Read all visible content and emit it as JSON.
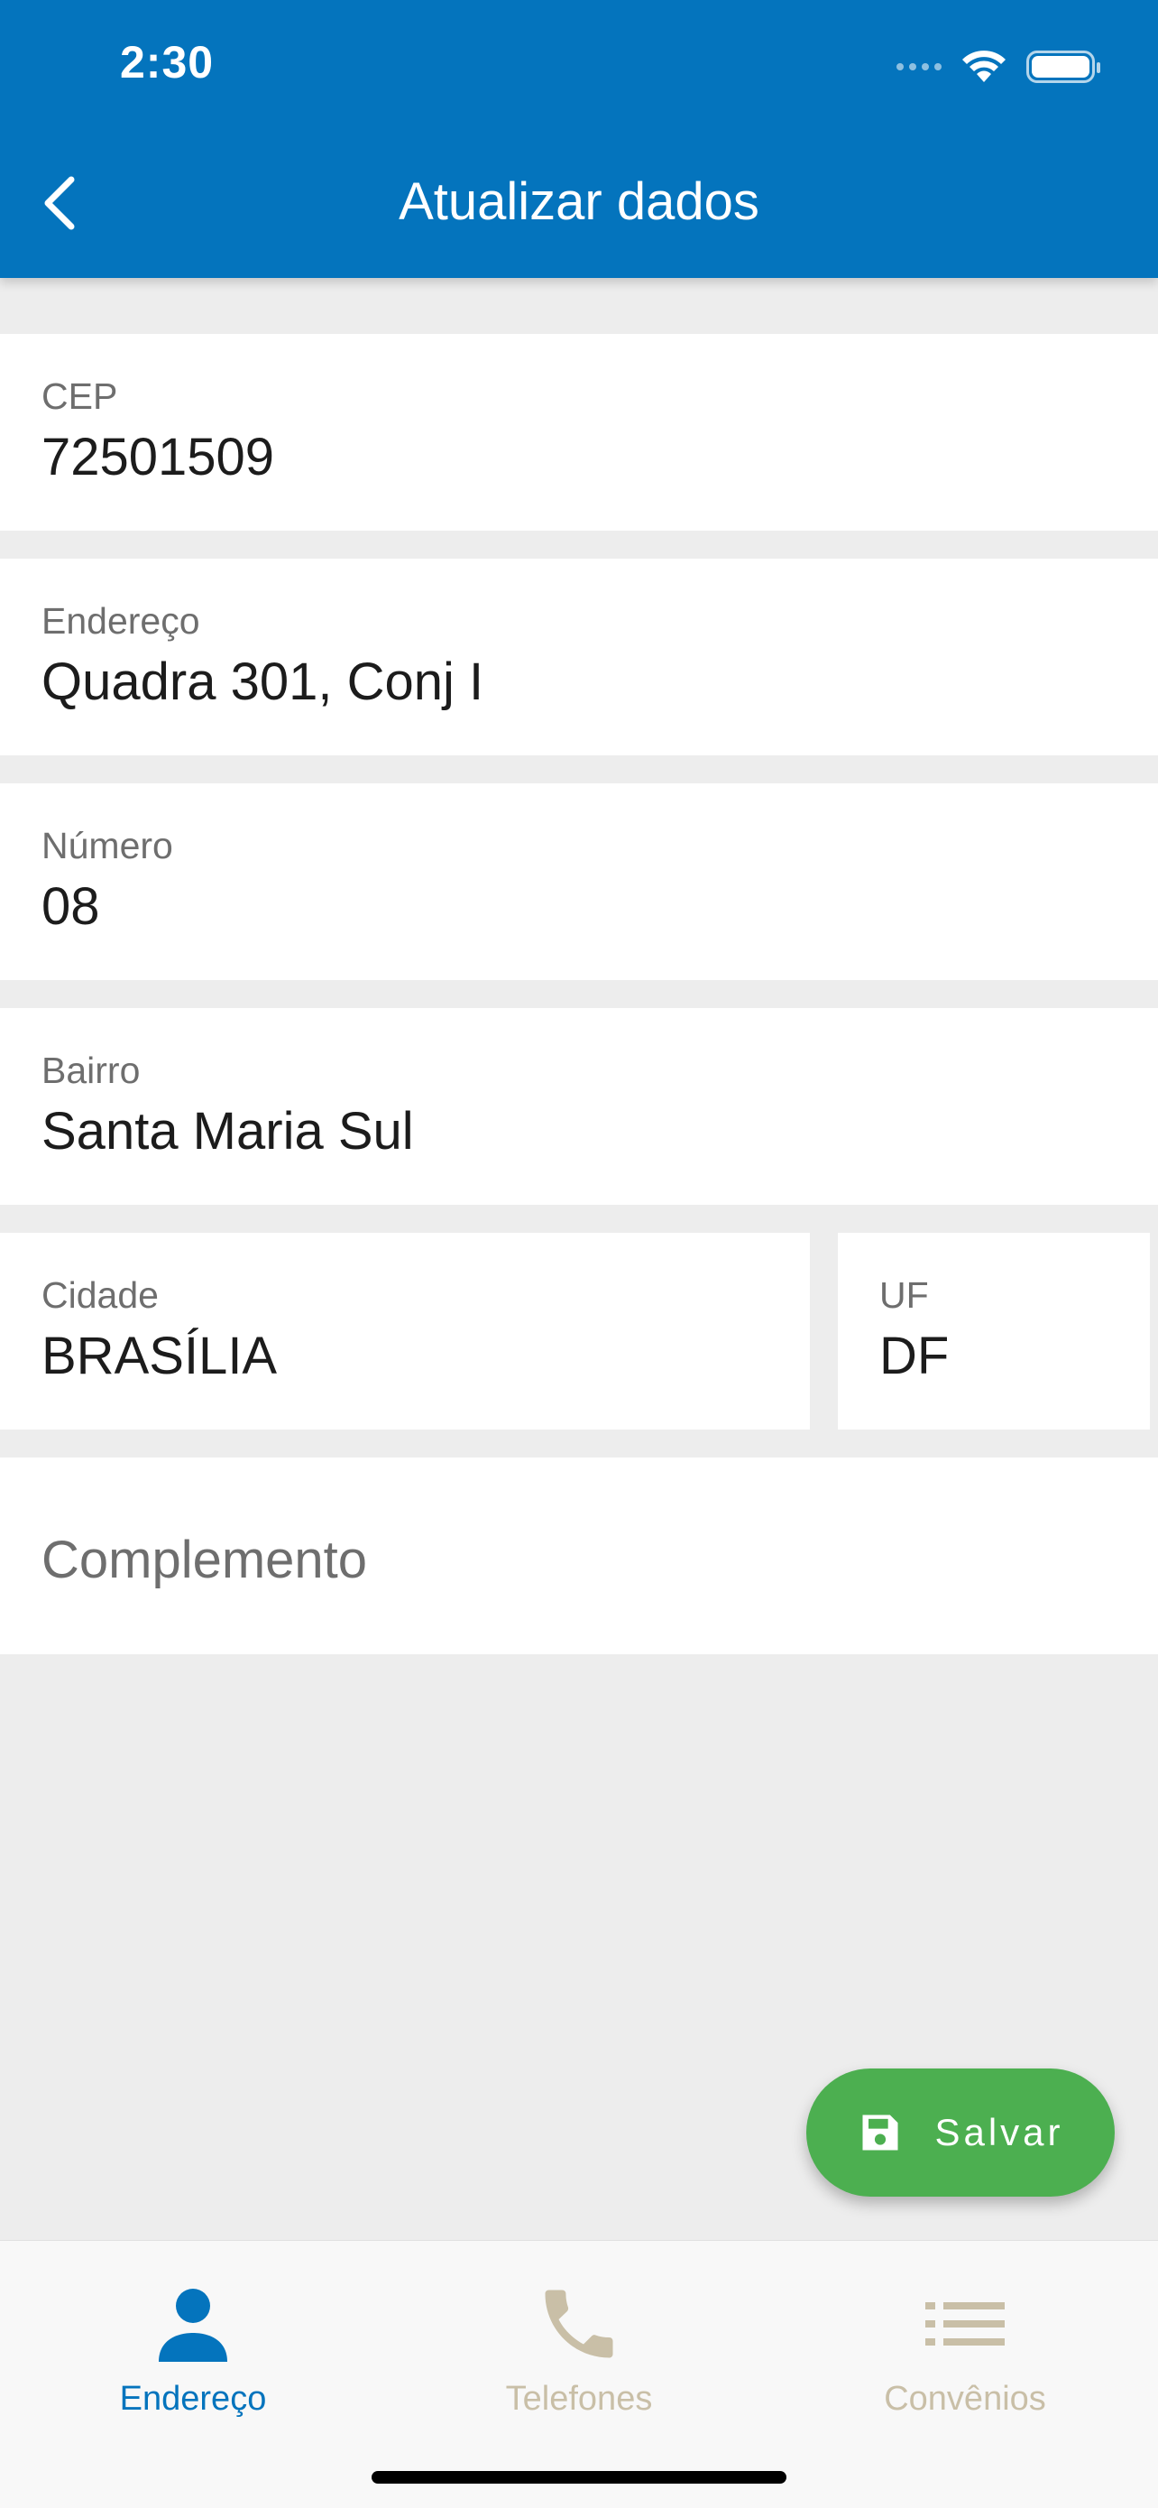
{
  "status_bar": {
    "time": "2:30"
  },
  "header": {
    "title": "Atualizar dados",
    "back_icon": "chevron-left-icon"
  },
  "form": {
    "cep": {
      "label": "CEP",
      "value": "72501509"
    },
    "endereco": {
      "label": "Endereço",
      "value": "Quadra 301, Conj I"
    },
    "numero": {
      "label": "Número",
      "value": "08"
    },
    "bairro": {
      "label": "Bairro",
      "value": "Santa Maria Sul"
    },
    "cidade": {
      "label": "Cidade",
      "value": "BRASÍLIA"
    },
    "uf": {
      "label": "UF",
      "value": "DF"
    },
    "complemento": {
      "placeholder": "Complemento",
      "value": ""
    }
  },
  "save_button": {
    "label": "Salvar",
    "icon": "floppy-disk-icon",
    "color": "#4caf50"
  },
  "bottom_nav": {
    "items": [
      {
        "label": "Endereço",
        "icon": "person-icon",
        "active": true
      },
      {
        "label": "Telefones",
        "icon": "phone-icon",
        "active": false
      },
      {
        "label": "Convênios",
        "icon": "list-icon",
        "active": false
      }
    ],
    "active_color": "#0474bd",
    "inactive_color": "#c9bfa7"
  },
  "colors": {
    "header_bg": "#0474bd",
    "page_bg": "#ededed"
  }
}
